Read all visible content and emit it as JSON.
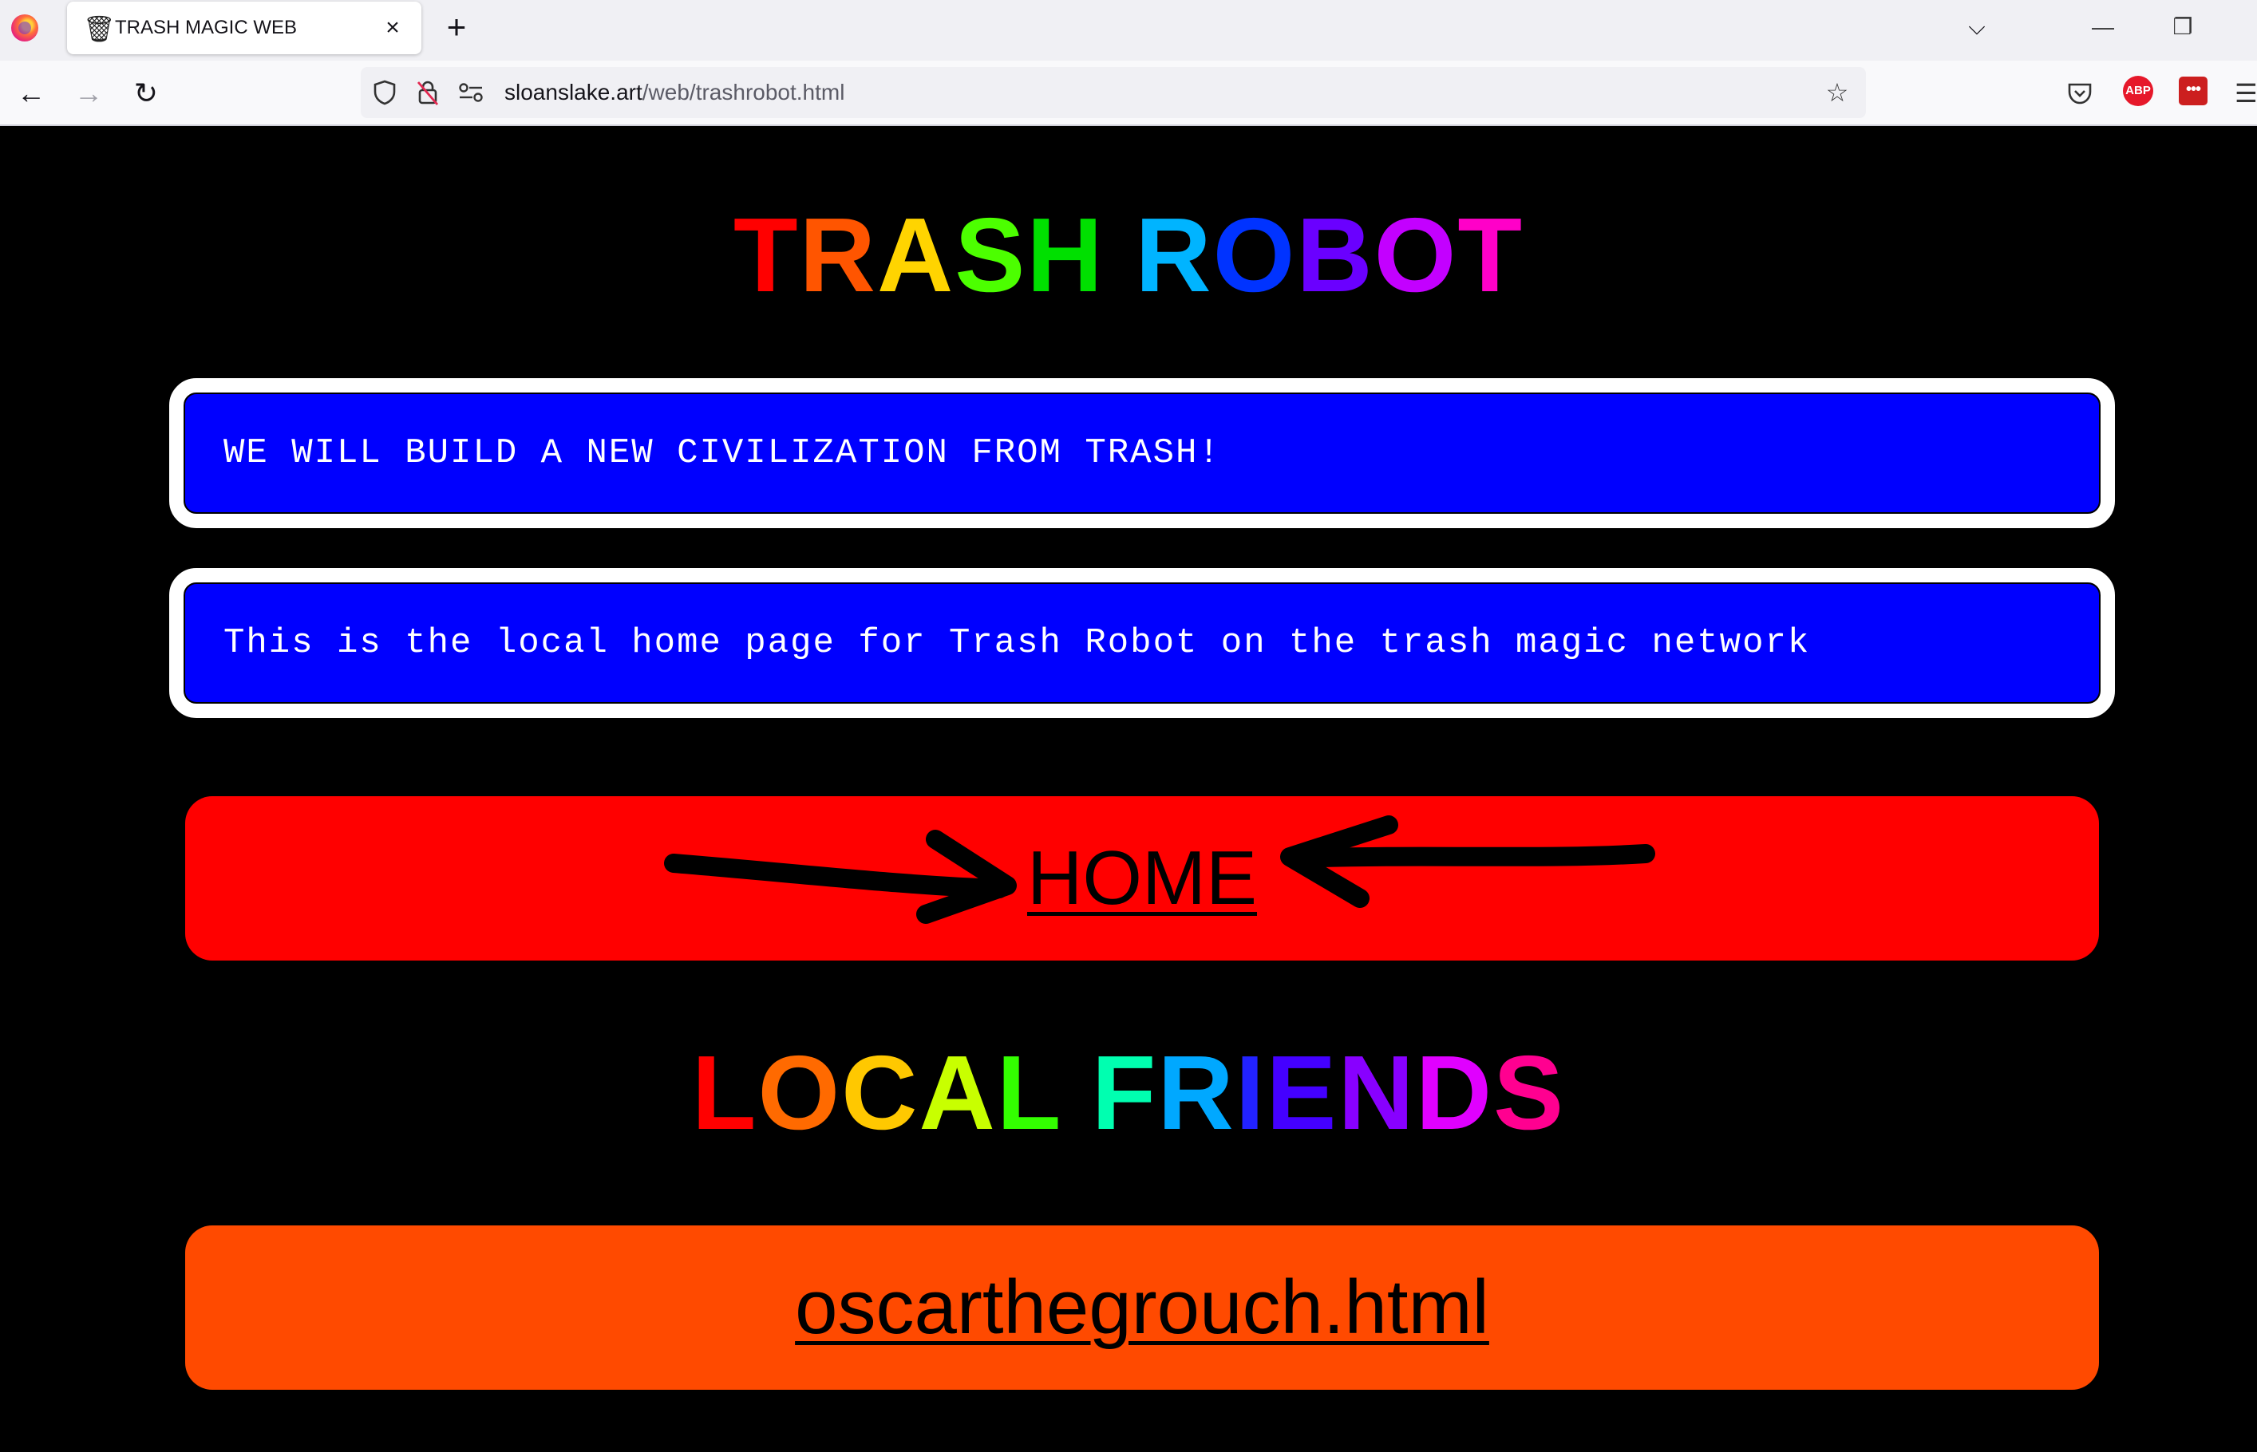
{
  "browser": {
    "tab": {
      "title": "TRASH MAGIC WEB",
      "icon": "trash-icon",
      "close": "×"
    },
    "new_tab": "+",
    "tabs_list": "⌵",
    "window": {
      "minimize": "—",
      "restore": "❐"
    },
    "nav": {
      "back": "←",
      "forward": "→",
      "reload": "↻"
    },
    "url": {
      "domain": "sloanslake.art",
      "path": "/web/trashrobot.html"
    },
    "extensions": {
      "abp": "ABP",
      "red_ext": "•••"
    }
  },
  "page": {
    "title": {
      "words": [
        [
          {
            "c": "T",
            "color": "#ff0000"
          },
          {
            "c": "R",
            "color": "#ff5500"
          },
          {
            "c": "A",
            "color": "#ffd400"
          },
          {
            "c": "S",
            "color": "#4cff00"
          },
          {
            "c": "H",
            "color": "#00e000"
          }
        ],
        [
          {
            "c": "R",
            "color": "#00b4ff"
          },
          {
            "c": "O",
            "color": "#0033ff"
          },
          {
            "c": "B",
            "color": "#6a00ff"
          },
          {
            "c": "O",
            "color": "#c300ff"
          },
          {
            "c": "T",
            "color": "#ff00c8"
          }
        ]
      ]
    },
    "banner1": "WE WILL BUILD A NEW CIVILIZATION FROM TRASH!",
    "banner2": "This is the local home page for Trash Robot on the trash magic network",
    "home_link": "HOME",
    "friends_title": {
      "words": [
        [
          {
            "c": "L",
            "color": "#ff0000"
          },
          {
            "c": "O",
            "color": "#ff6a00"
          },
          {
            "c": "C",
            "color": "#ffc800"
          },
          {
            "c": "A",
            "color": "#c8ff00"
          },
          {
            "c": "L",
            "color": "#33ff00"
          }
        ],
        [
          {
            "c": "F",
            "color": "#00ffb0"
          },
          {
            "c": "R",
            "color": "#00a8ff"
          },
          {
            "c": "I",
            "color": "#2222ff"
          },
          {
            "c": "E",
            "color": "#4400ff"
          },
          {
            "c": "N",
            "color": "#8800ff"
          },
          {
            "c": "D",
            "color": "#e000ff"
          },
          {
            "c": "S",
            "color": "#ff0090"
          }
        ]
      ]
    },
    "friends": [
      "oscarthegrouch.html"
    ],
    "colors": {
      "banner_blue": "#0000ff",
      "home_red": "#ff0000",
      "friend_orange": "#ff4a00"
    }
  }
}
